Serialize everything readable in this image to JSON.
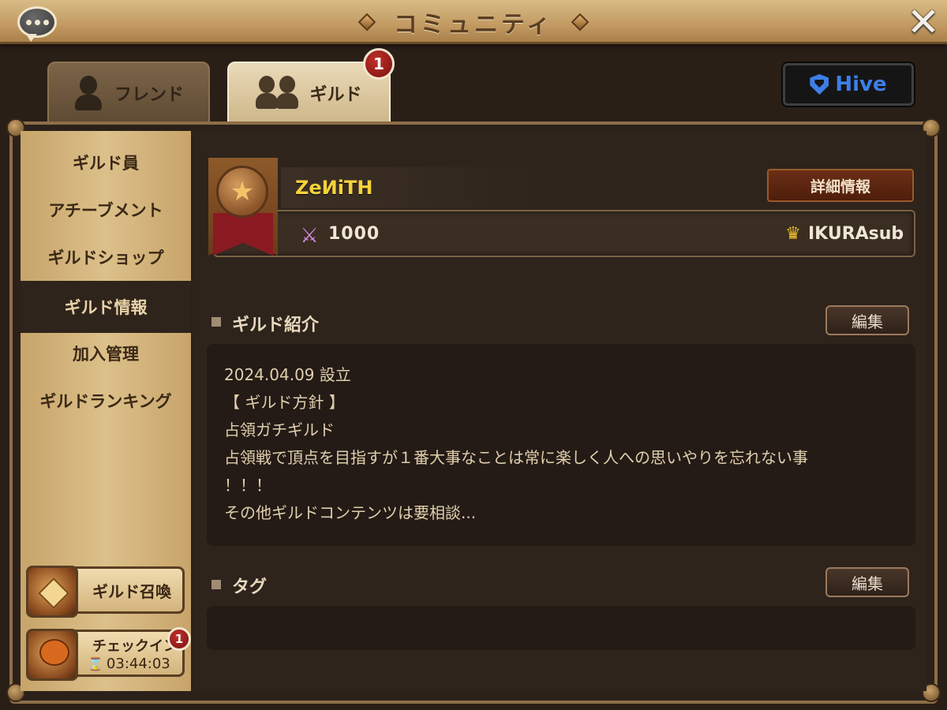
{
  "header": {
    "title": "コミュニティ"
  },
  "tabs": [
    {
      "label": "フレンド",
      "active": false
    },
    {
      "label": "ギルド",
      "active": true,
      "badge": "1"
    }
  ],
  "hive": {
    "label": "Hive"
  },
  "sidebar": {
    "items": [
      {
        "label": "ギルド員"
      },
      {
        "label": "アチーブメント"
      },
      {
        "label": "ギルドショップ"
      },
      {
        "label": "ギルド情報",
        "active": true
      },
      {
        "label": "加入管理"
      },
      {
        "label": "ギルドランキング"
      }
    ],
    "summon_label": "ギルド召喚",
    "checkin": {
      "label": "チェックイン",
      "timer": "03:44:03",
      "badge": "1"
    }
  },
  "guild": {
    "name": "ZeИiTH",
    "detail_label": "詳細情報",
    "points": "1000",
    "leader": "IKURAsub"
  },
  "sections": {
    "intro_title": "ギルド紹介",
    "tags_title": "タグ",
    "edit_label": "編集",
    "intro_lines": [
      "2024.04.09 設立",
      "【 ギルド方針 】",
      "占領ガチギルド",
      "占領戦で頂点を目指すが１番大事なことは常に楽しく人への思いやりを忘れない事",
      "！！！",
      "その他ギルドコンテンツは要相談..."
    ]
  },
  "colors": {
    "accent_gold": "#f5d23a",
    "badge_red": "#a3201c",
    "hive_blue": "#3d7ee6"
  }
}
